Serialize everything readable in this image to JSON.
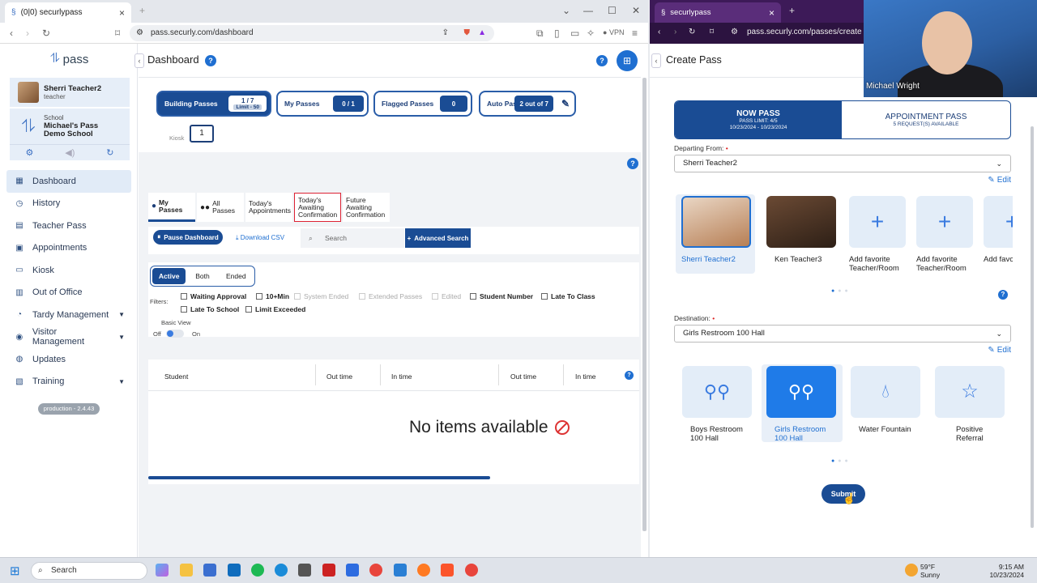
{
  "left_browser": {
    "tab_title": "(0|0) securlypass",
    "url": "pass.securly.com/dashboard",
    "vpn_label": "VPN"
  },
  "sidebar": {
    "logo_text": "pass",
    "user": {
      "name": "Sherri Teacher2",
      "role": "teacher"
    },
    "school": {
      "label": "School",
      "name_line1": "Michael's Pass",
      "name_line2": "Demo School"
    },
    "items": [
      {
        "label": "Dashboard",
        "icon": "grid-icon",
        "active": true
      },
      {
        "label": "History",
        "icon": "history-icon"
      },
      {
        "label": "Teacher Pass",
        "icon": "pass-icon"
      },
      {
        "label": "Appointments",
        "icon": "calendar-icon"
      },
      {
        "label": "Kiosk",
        "icon": "kiosk-icon"
      },
      {
        "label": "Out of Office",
        "icon": "building-icon"
      },
      {
        "label": "Tardy Management",
        "icon": "clock-icon",
        "expandable": true
      },
      {
        "label": "Visitor Management",
        "icon": "person-icon",
        "expandable": true
      },
      {
        "label": "Updates",
        "icon": "globe-icon"
      },
      {
        "label": "Training",
        "icon": "book-icon",
        "expandable": true
      }
    ],
    "version": "production - 2.4.43"
  },
  "dashboard": {
    "title": "Dashboard",
    "counters": [
      {
        "label": "Building Passes",
        "value": "1 / 7",
        "sub": "Limit - 50"
      },
      {
        "label": "My Passes",
        "value": "0 / 1"
      },
      {
        "label": "Flagged Passes",
        "value": "0"
      },
      {
        "label": "Auto Passes",
        "value": "2 out of 7"
      }
    ],
    "kiosk_label": "Kiosk",
    "kiosk_count": "1",
    "pass_tabs": [
      {
        "line1": "My",
        "line2": "Passes"
      },
      {
        "line1": "All",
        "line2": "Passes"
      },
      {
        "line1": "Today's",
        "line2": "Appointments"
      },
      {
        "line1": "Today's",
        "line2": "Awaiting",
        "line3": "Confirmation"
      },
      {
        "line1": "Future",
        "line2": "Awaiting",
        "line3": "Confirmation"
      }
    ],
    "pause_button": "Pause Dashboard",
    "download_csv": "Download CSV",
    "search_placeholder": "Search",
    "advanced_search": "Advanced Search",
    "status_segments": [
      "Active",
      "Both",
      "Ended"
    ],
    "filters_label": "Filters:",
    "filters": [
      {
        "label": "Waiting Approval",
        "enabled": true
      },
      {
        "label": "10+Min",
        "enabled": true
      },
      {
        "label": "System Ended",
        "enabled": false
      },
      {
        "label": "Extended Passes",
        "enabled": false
      },
      {
        "label": "Edited",
        "enabled": false
      },
      {
        "label": "Student Number",
        "enabled": true
      },
      {
        "label": "Late To Class",
        "enabled": true
      },
      {
        "label": "Late To School",
        "enabled": true
      },
      {
        "label": "Limit Exceeded",
        "enabled": true
      }
    ],
    "basic_view": {
      "label": "Basic View",
      "off": "Off",
      "on": "On"
    },
    "table_headers": [
      "Student",
      "Out time",
      "In time",
      "Out time",
      "In time"
    ],
    "empty_message": "No items available"
  },
  "right_browser": {
    "tab_title": "securlypass",
    "url": "pass.securly.com/passes/create"
  },
  "create_pass": {
    "title": "Create Pass",
    "now_pass": {
      "title": "NOW PASS",
      "limit": "PASS LIMIT: 4/5",
      "dates": "10/23/2024 - 10/23/2024"
    },
    "appointment_pass": {
      "title": "APPOINTMENT PASS",
      "sub": "5 REQUEST(S) AVAILABLE"
    },
    "departing_label": "Departing From:",
    "departing_value": "Sherri Teacher2",
    "edit_label": "Edit",
    "departing_tiles": [
      {
        "label": "Sherri Teacher2",
        "selected": true
      },
      {
        "label": "Ken Teacher3"
      },
      {
        "label": "Add favorite Teacher/Room"
      },
      {
        "label": "Add favorite Teacher/Room"
      },
      {
        "label": "Add favorite Teacher/Room"
      }
    ],
    "destination_label": "Destination:",
    "destination_value": "Girls Restroom 100 Hall",
    "destination_tiles": [
      {
        "label": "Boys Restroom 100 Hall",
        "icon": "restroom-icon"
      },
      {
        "label": "Girls Restroom 100 Hall",
        "icon": "restroom-icon",
        "selected": true
      },
      {
        "label": "Water Fountain",
        "icon": "water-drop-icon"
      },
      {
        "label": "Positive Referral",
        "icon": "star-icon"
      }
    ],
    "submit": "Submit"
  },
  "video": {
    "participant": "Michael Wright"
  },
  "taskbar": {
    "search_placeholder": "Search",
    "weather_temp": "59°F",
    "weather_desc": "Sunny",
    "time": "9:15 AM",
    "date": "10/23/2024"
  }
}
